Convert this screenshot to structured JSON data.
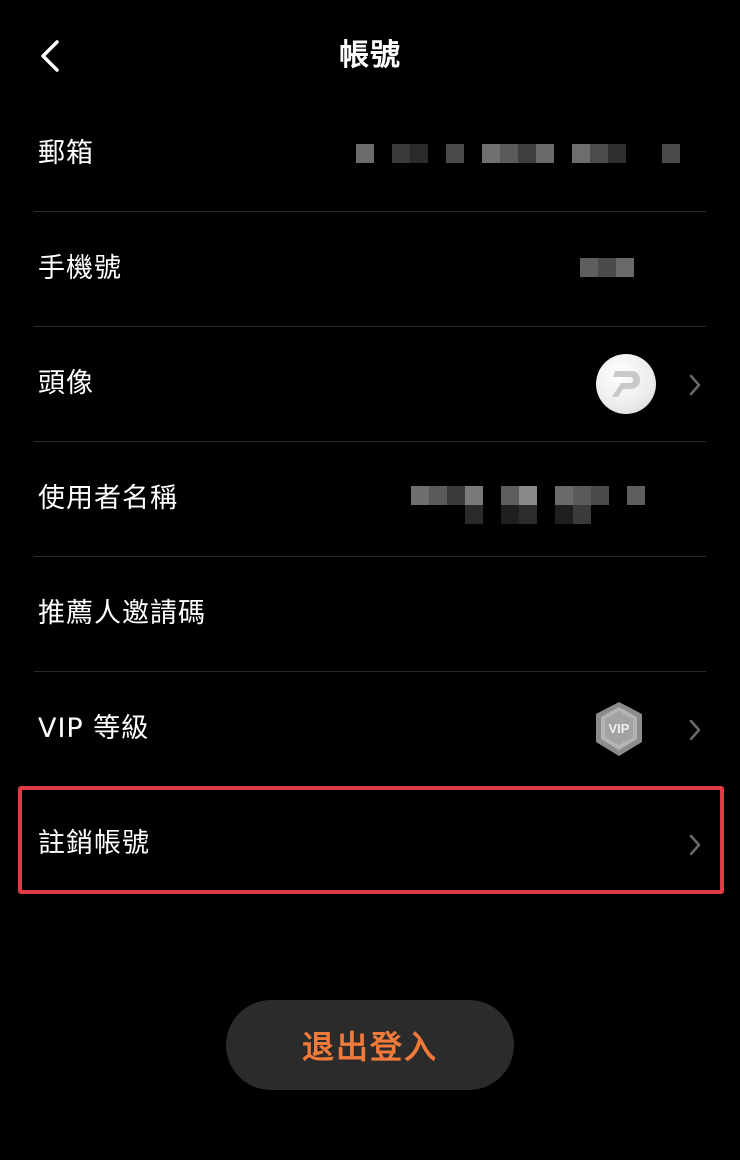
{
  "header": {
    "title": "帳號"
  },
  "rows": [
    {
      "label": "郵箱"
    },
    {
      "label": "手機號"
    },
    {
      "label": "頭像"
    },
    {
      "label": "使用者名稱"
    },
    {
      "label": "推薦人邀請碼"
    },
    {
      "label": "VIP 等級"
    },
    {
      "label": "註銷帳號"
    }
  ],
  "vip": {
    "badge_text": "VIP"
  },
  "logout": {
    "label": "退出登入"
  },
  "colors": {
    "background": "#000000",
    "accent": "#f07a3a",
    "highlight": "#e03a44",
    "button_bg": "#2b2b2b"
  }
}
